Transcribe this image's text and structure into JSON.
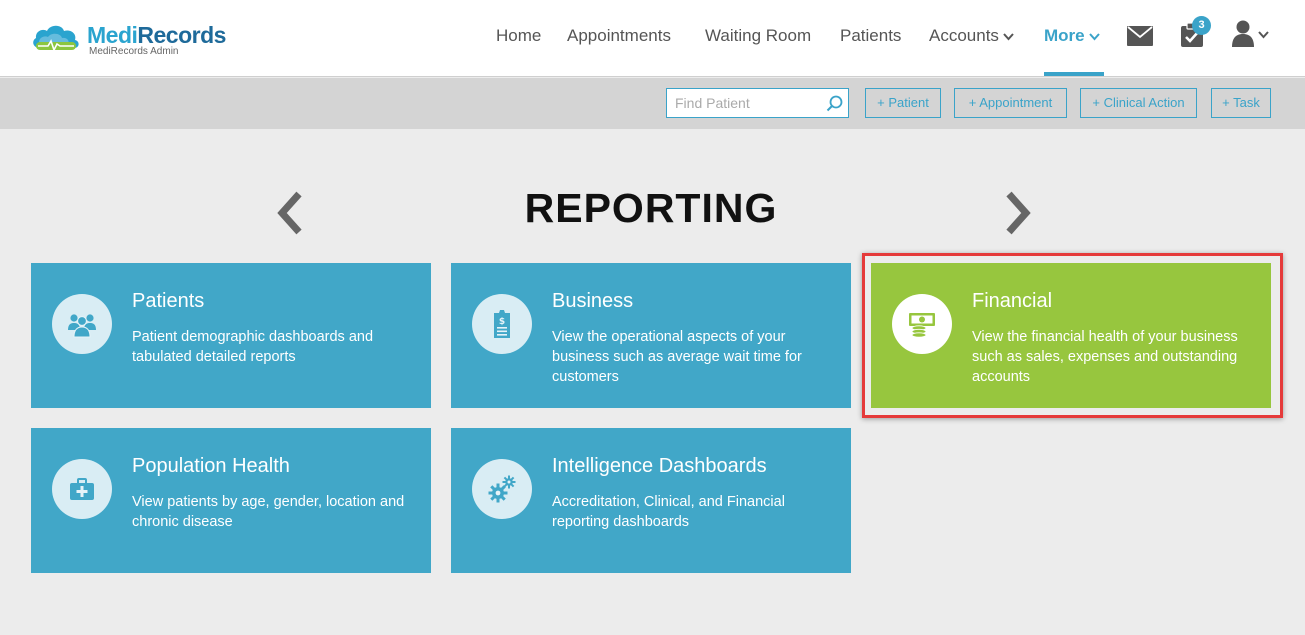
{
  "app": {
    "logo_name_part1": "Medi",
    "logo_name_part2": "Records",
    "logo_subtitle": "MediRecords Admin"
  },
  "nav": {
    "items": [
      {
        "label": "Home"
      },
      {
        "label": "Appointments"
      },
      {
        "label": "Waiting Room"
      },
      {
        "label": "Patients"
      },
      {
        "label": "Accounts"
      },
      {
        "label": "More"
      }
    ],
    "active": "More",
    "task_count": "3"
  },
  "toolbar": {
    "search_placeholder": "Find Patient",
    "buttons": [
      {
        "label": "+ Patient"
      },
      {
        "label": "+ Appointment"
      },
      {
        "label": "+ Clinical Action"
      },
      {
        "label": "+ Task"
      }
    ]
  },
  "main": {
    "title": "REPORTING",
    "cards": [
      {
        "title": "Patients",
        "description": "Patient demographic dashboards and tabulated detailed reports",
        "icon": "users-icon"
      },
      {
        "title": "Business",
        "description": "View the operational aspects of your business such as average wait time for customers",
        "icon": "receipt-icon"
      },
      {
        "title": "Financial",
        "description": "View the financial health of your business such as sales, expenses and outstanding accounts",
        "icon": "money-icon"
      },
      {
        "title": "Population Health",
        "description": "View patients by age, gender, location and chronic disease",
        "icon": "medkit-icon"
      },
      {
        "title": "Intelligence Dashboards",
        "description": "Accreditation, Clinical, and Financial reporting dashboards",
        "icon": "gears-icon"
      }
    ]
  },
  "colors": {
    "accent": "#3aa3c9",
    "card_blue": "#41a7c8",
    "card_green": "#97c63e",
    "highlight": "#e53a3a"
  }
}
